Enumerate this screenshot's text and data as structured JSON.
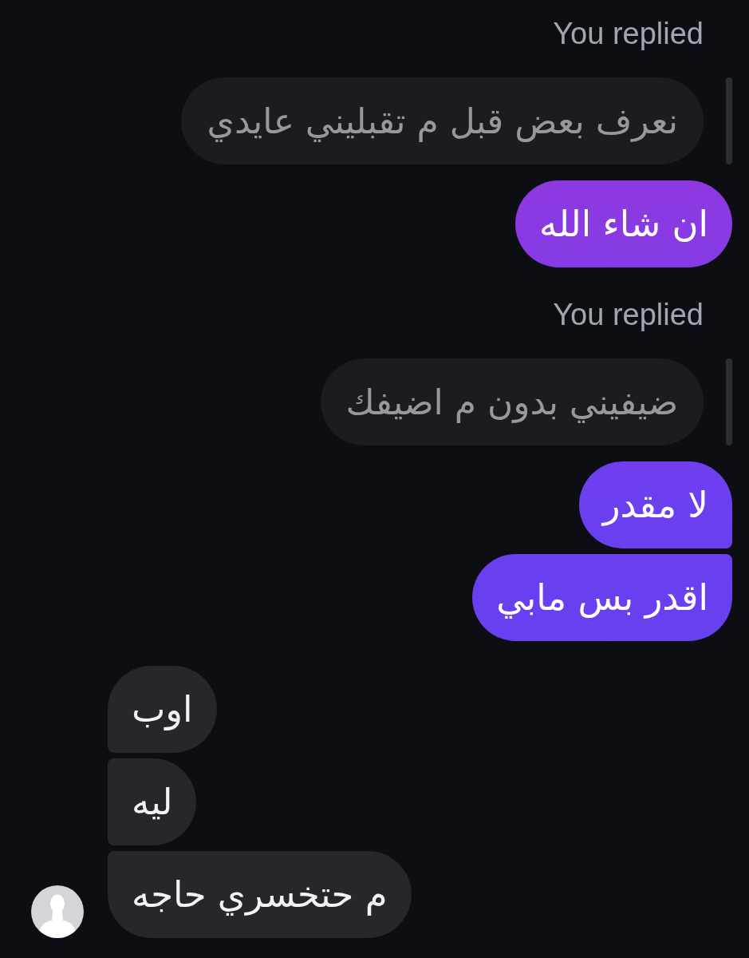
{
  "conversation": [
    {
      "kind": "reply",
      "label": "You replied",
      "quote": "نعرف بعض قبل م تقبليني عايدي"
    },
    {
      "kind": "sent",
      "text": "ان شاء الله"
    },
    {
      "kind": "reply",
      "label": "You replied",
      "quote": "ضيفيني بدون م اضيفك"
    },
    {
      "kind": "sent",
      "text": "لا مقدر"
    },
    {
      "kind": "sent",
      "text": "اقدر بس مابي"
    },
    {
      "kind": "received",
      "text": "اوب"
    },
    {
      "kind": "received",
      "text": "ليه"
    },
    {
      "kind": "received",
      "text": "م حتخسري حاجه"
    }
  ]
}
